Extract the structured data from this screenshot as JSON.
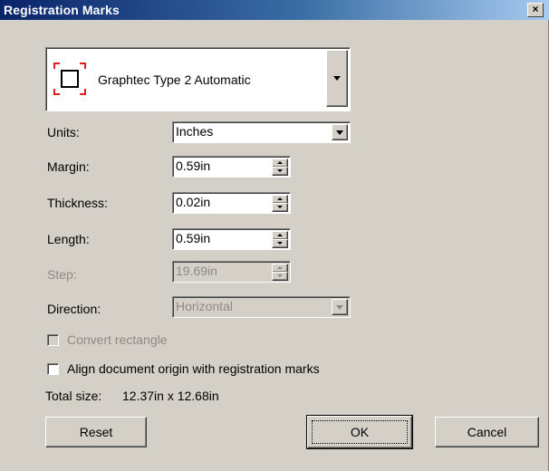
{
  "window": {
    "title": "Registration Marks",
    "close_glyph": "×"
  },
  "mark_type": {
    "selected": "Graphtec Type 2 Automatic",
    "icon": "registration-mark-icon"
  },
  "fields": {
    "units": {
      "label": "Units:",
      "value": "Inches"
    },
    "margin": {
      "label": "Margin:",
      "value": "0.59in"
    },
    "thickness": {
      "label": "Thickness:",
      "value": "0.02in"
    },
    "length": {
      "label": "Length:",
      "value": "0.59in"
    },
    "step": {
      "label": "Step:",
      "value": "19.69in",
      "enabled": false
    },
    "direction": {
      "label": "Direction:",
      "value": "Horizontal",
      "enabled": false
    }
  },
  "checkboxes": {
    "convert_rectangle": {
      "label": "Convert rectangle",
      "checked": false,
      "enabled": false
    },
    "align_origin": {
      "label": "Align document origin with registration marks",
      "checked": false,
      "enabled": true
    }
  },
  "total_size": {
    "label": "Total size:",
    "value": "12.37in x 12.68in"
  },
  "buttons": {
    "reset": "Reset",
    "ok": "OK",
    "cancel": "Cancel"
  },
  "colors": {
    "dialog_bg": "#d4d0c8",
    "title_start": "#0a246a",
    "title_end": "#a6caf0",
    "mark_corner": "#e02020",
    "disabled_text": "#8d8a84"
  }
}
